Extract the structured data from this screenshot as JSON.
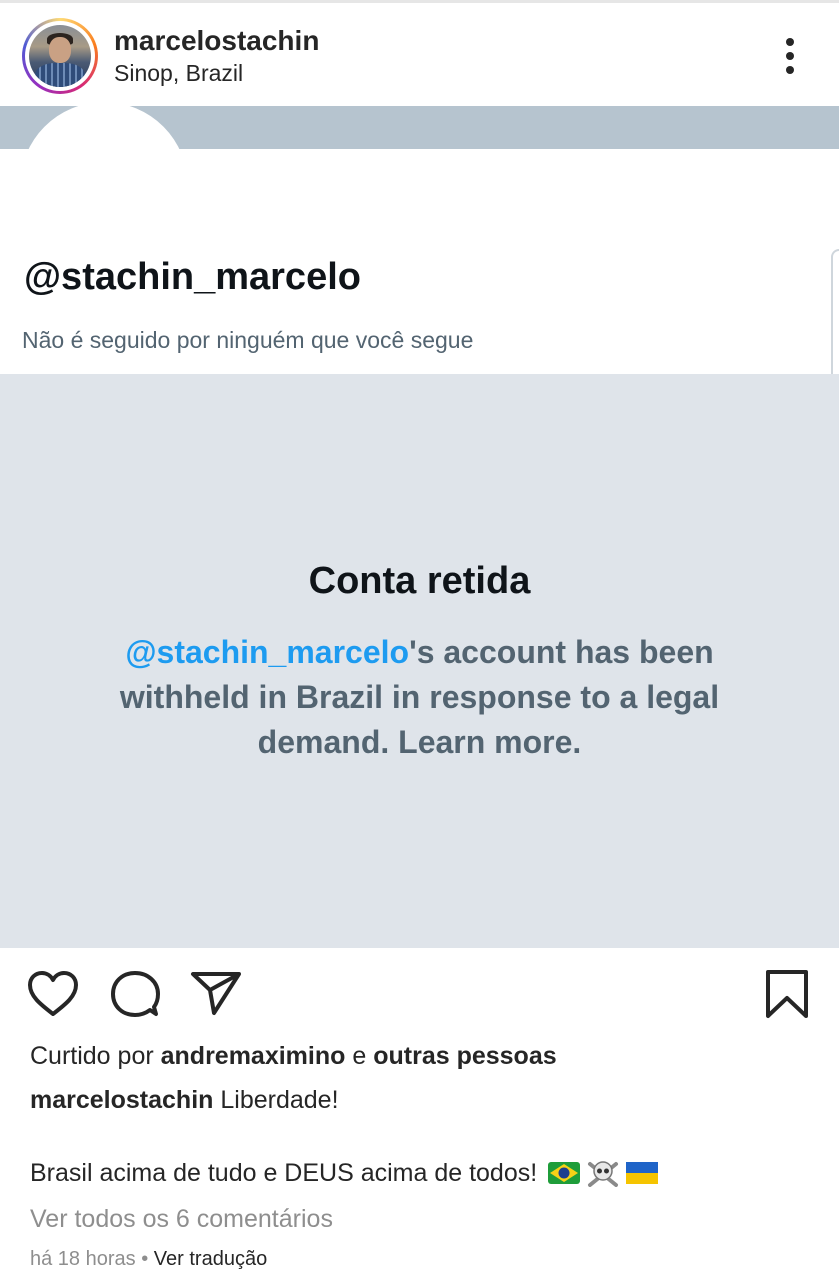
{
  "post": {
    "username": "marcelostachin",
    "location": "Sinop, Brazil"
  },
  "media": {
    "handle": "@stachin_marcelo",
    "not_followed": "Não é seguido por ninguém que você segue",
    "withheld_title": "Conta retida",
    "withheld_mention": "@stachin_marcelo",
    "withheld_rest": "'s account has been withheld in Brazil in response to a legal demand. Learn more."
  },
  "likes": {
    "prefix": "Curtido por",
    "user": "andremaximino",
    "conj": "e",
    "others": "outras pessoas"
  },
  "caption": {
    "user": "marcelostachin",
    "text": "Liberdade!",
    "line2": "Brasil acima de tudo e DEUS acima de todos!",
    "emojis": [
      "brazil-flag",
      "skull-and-crossbones",
      "ukraine-flag"
    ]
  },
  "comments": {
    "view_all": "Ver todos os 6 comentários"
  },
  "meta": {
    "time": "há 18 horas",
    "separator": "•",
    "translate": "Ver tradução"
  },
  "icons": {
    "like": "heart-icon",
    "comment": "comment-icon",
    "share": "send-icon",
    "save": "bookmark-icon",
    "more": "more-vertical-icon"
  },
  "colors": {
    "link_blue": "#1d9bf0",
    "withheld_bg": "#dfe4ea",
    "banner": "#b6c4cf",
    "muted": "#8e8e8e"
  }
}
